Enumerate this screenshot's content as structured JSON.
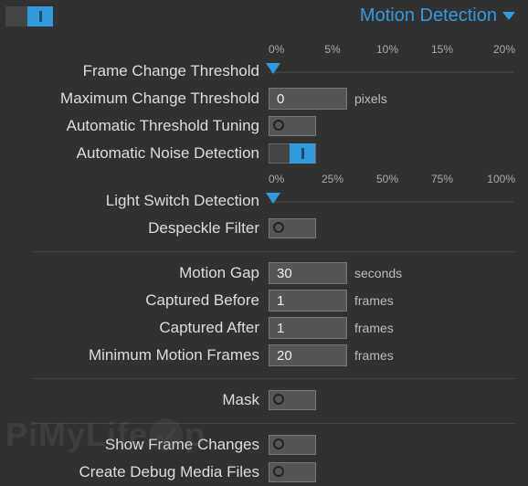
{
  "header": {
    "title": "Motion Detection",
    "enabled": true
  },
  "ticks_a": [
    "0%",
    "5%",
    "10%",
    "15%",
    "20%"
  ],
  "ticks_b": [
    "0%",
    "25%",
    "50%",
    "75%",
    "100%"
  ],
  "labels": {
    "frameChange": "Frame Change Threshold",
    "maxChange": "Maximum Change Threshold",
    "autoTune": "Automatic Threshold Tuning",
    "autoNoise": "Automatic Noise Detection",
    "lightSwitch": "Light Switch Detection",
    "despeckle": "Despeckle Filter",
    "motionGap": "Motion Gap",
    "capBefore": "Captured Before",
    "capAfter": "Captured After",
    "minMotion": "Minimum Motion Frames",
    "mask": "Mask",
    "showChanges": "Show Frame Changes",
    "debugMedia": "Create Debug Media Files"
  },
  "values": {
    "maxChange": "0",
    "motionGap": "30",
    "capBefore": "1",
    "capAfter": "1",
    "minMotion": "20"
  },
  "units": {
    "pixels": "pixels",
    "seconds": "seconds",
    "frames": "frames"
  },
  "toggles": {
    "autoTune": false,
    "autoNoise": true,
    "despeckle": false,
    "mask": false,
    "showChanges": false,
    "debugMedia": false
  },
  "sliders": {
    "frameChangePct": 2,
    "lightSwitchPct": 2
  },
  "watermark": "PiMyLifeUp"
}
